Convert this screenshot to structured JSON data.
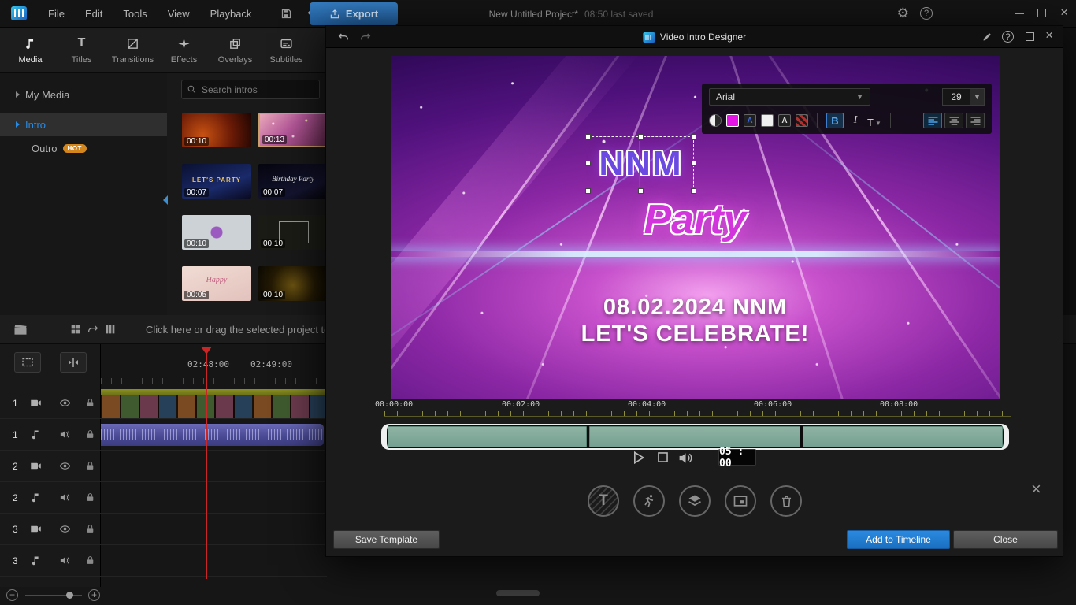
{
  "app": {
    "menus": [
      "File",
      "Edit",
      "Tools",
      "View",
      "Playback"
    ],
    "export_label": "Export",
    "project_title": "New Untitled Project*",
    "saved_status": "08:50 last saved"
  },
  "sidebar": {
    "tabs": [
      "Media",
      "Titles",
      "Transitions",
      "Effects",
      "Overlays",
      "Subtitles"
    ],
    "tree": {
      "my_media": "My Media",
      "intro": "Intro",
      "outro": "Outro",
      "outro_badge": "HOT"
    },
    "search_placeholder": "Search intros"
  },
  "thumbnails": [
    {
      "duration": "00:10",
      "caption": ""
    },
    {
      "duration": "00:13",
      "caption": ""
    },
    {
      "duration": "00:07",
      "caption": "LET'S PARTY"
    },
    {
      "duration": "00:07",
      "caption": "Birthday Party"
    },
    {
      "duration": "00:10",
      "caption": ""
    },
    {
      "duration": "00:10",
      "caption": ""
    },
    {
      "duration": "00:05",
      "caption": "Happy"
    },
    {
      "duration": "00:10",
      "caption": ""
    }
  ],
  "timeline": {
    "hint": "Click here or drag the selected project to a t",
    "ruler": [
      "02:48:00",
      "02:49:00"
    ],
    "tracks": [
      {
        "number": "1",
        "type": "video"
      },
      {
        "number": "1",
        "type": "audio"
      },
      {
        "number": "2",
        "type": "video"
      },
      {
        "number": "2",
        "type": "audio"
      },
      {
        "number": "3",
        "type": "video"
      },
      {
        "number": "3",
        "type": "audio"
      }
    ]
  },
  "dialog": {
    "title": "Video Intro Designer",
    "toolbar": {
      "font": "Arial",
      "size": "29",
      "bold": "B",
      "italic": "I",
      "text_btn": "T"
    },
    "preview": {
      "title_text": "NNM",
      "party_text": "Party",
      "date_text": "08.02.2024 NNM",
      "celebrate_text": "LET'S CELEBRATE!"
    },
    "ruler": [
      "00:00:00",
      "00:02:00",
      "00:04:00",
      "00:06:00",
      "00:08:00"
    ],
    "time_display": "05 : 00",
    "buttons": {
      "save_template": "Save Template",
      "add_to_timeline": "Add to Timeline",
      "close": "Close"
    }
  },
  "colors": {
    "accent": "#2a8ae0",
    "export_blue": "#2f74b4",
    "trim_green": "#8fb3a4",
    "hot_orange": "#d2861c",
    "magenta": "#d335dd",
    "purple": "#6a4ae0"
  }
}
